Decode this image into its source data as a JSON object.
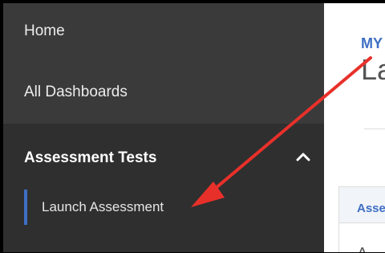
{
  "sidebar": {
    "items": [
      {
        "label": "Home"
      },
      {
        "label": "All Dashboards"
      }
    ],
    "section": {
      "title": "Assessment Tests",
      "expanded_icon": "chevron-up-icon",
      "items": [
        {
          "label": "Launch Assessment"
        }
      ]
    }
  },
  "main": {
    "breadcrumb": "MY",
    "title": "La",
    "panel": {
      "tab": "Asse",
      "text": "A"
    }
  },
  "annotation": {
    "arrow_color": "#e8302a"
  },
  "colors": {
    "sidebar_bg": "#3a3a3a",
    "section_bg": "#2f2f2f",
    "accent": "#3e6ec4"
  }
}
